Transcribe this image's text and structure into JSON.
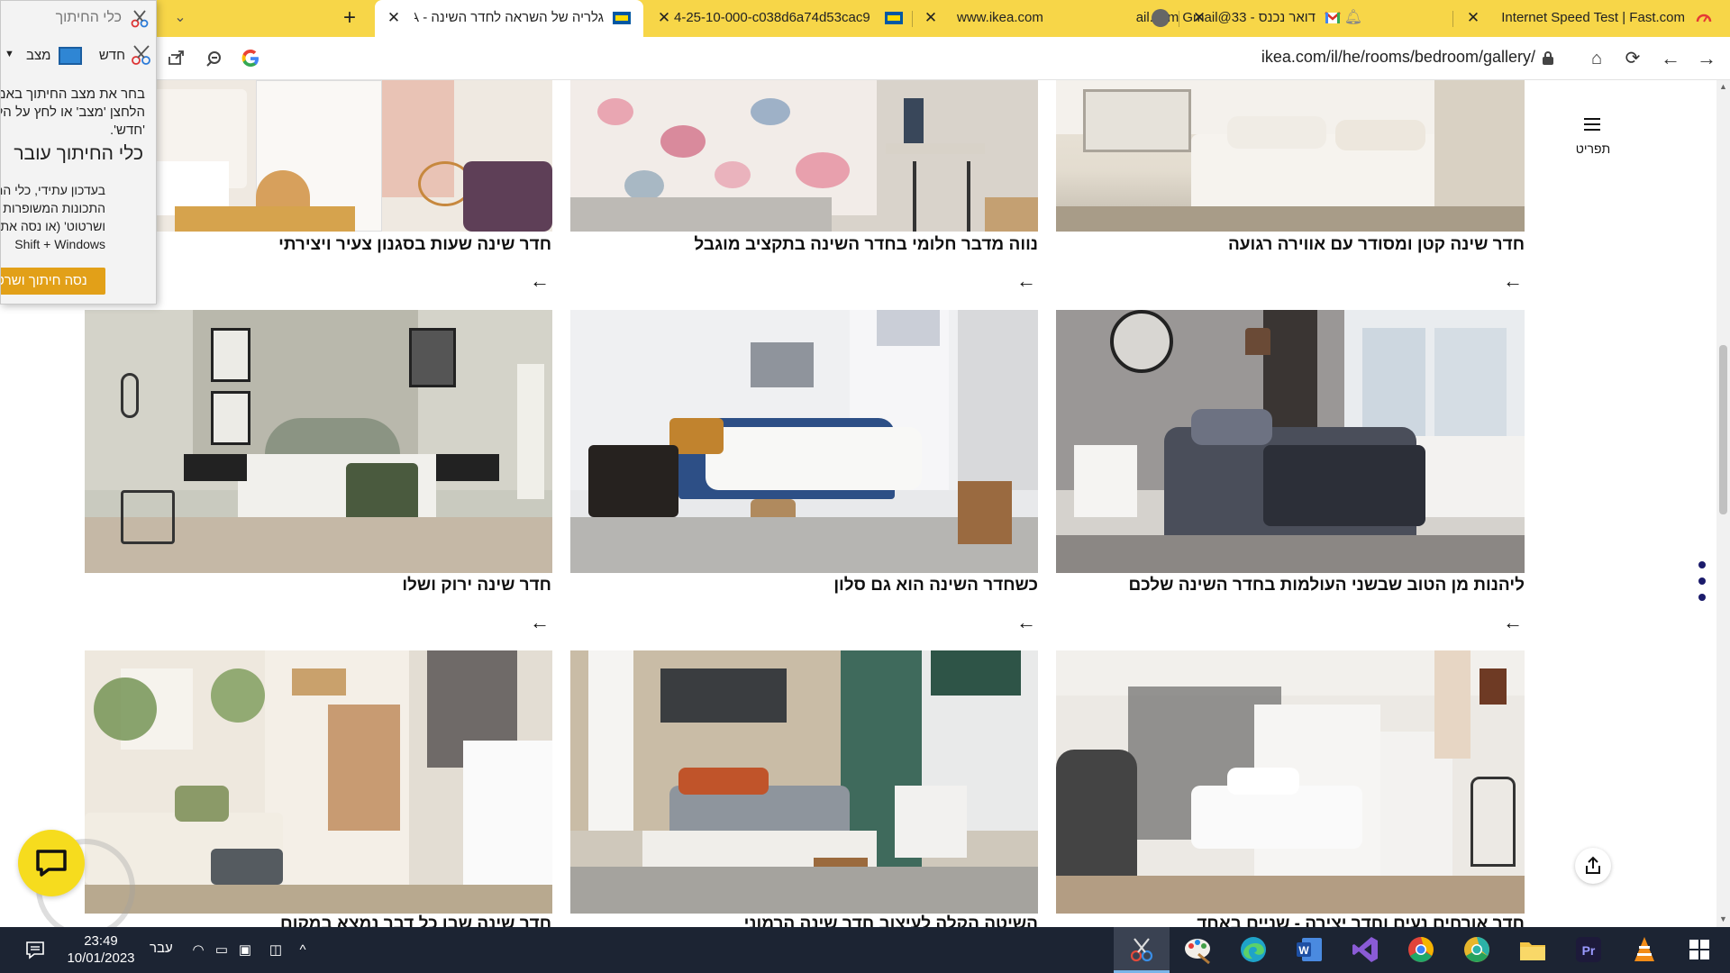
{
  "browser": {
    "tabs": [
      {
        "title": "Internet Speed Test | Fast.com",
        "icon": "fast-speed-icon"
      },
      {
        "title": "דואר נכנס - 33@gmail.com Gmail",
        "icon": "gmail-icon"
      },
      {
        "title": "www.ikea.com",
        "icon": "globe-icon"
      },
      {
        "title": "4-25-10-000-c038d6a74d53cac9",
        "icon": "ikea-icon"
      },
      {
        "title": "גלריה של השראה לחדר השינה - IKEA",
        "icon": "ikea-icon",
        "active": true
      }
    ],
    "address": "ikea.com/il/he/rooms/bedroom/gallery/"
  },
  "page": {
    "menu_label": "תפריט",
    "cards": [
      {
        "title": "חדר שינה קטן ומסודר עם אווירה רגועה"
      },
      {
        "title": "נווה מדבר חלומי בחדר השינה בתקציב מוגבל"
      },
      {
        "title": "חדר שינה שעות בסגנון צעיר ויצירתי"
      },
      {
        "title": "ליהנות מן הטוב שבשני העולמות בחדר השינה שלכם"
      },
      {
        "title": "כשחדר השינה הוא גם סלון"
      },
      {
        "title": "חדר שינה ירוק ושלו"
      },
      {
        "title": "חדר אורחים נעים וחדר יצירה - שניים באחד"
      },
      {
        "title": "השיטה הקלה לעיצוב חדר שינה הרמוני"
      },
      {
        "title": "חדר שינה שבו כל דבר נמצא במקום"
      }
    ]
  },
  "snipping_tool": {
    "title": "כלי החיתוך",
    "new_label": "חדש",
    "mode_label": "מצב",
    "instruction": "בחר את מצב החיתוך באמצעות הלחצן 'מצב' או לחץ על הלחצן 'חדש'.",
    "heading": "כלי החיתוך עובר",
    "body_lines": [
      "בעדכון עתידי, כלי החיתוך",
      "התכונות המשופרות ב'חיתוך",
      "ושרטוט' (או נסה את",
      "Shift + Windows"
    ],
    "button_label": "נסה חיתוך ושרטוט"
  },
  "taskbar": {
    "time": "23:49",
    "date": "10/01/2023",
    "language": "עבר"
  },
  "colors": {
    "tabbar": "#f7d648",
    "taskbar": "#1c2433",
    "snip_button": "#e2a018",
    "chat_bubble": "#f6dc1e"
  }
}
